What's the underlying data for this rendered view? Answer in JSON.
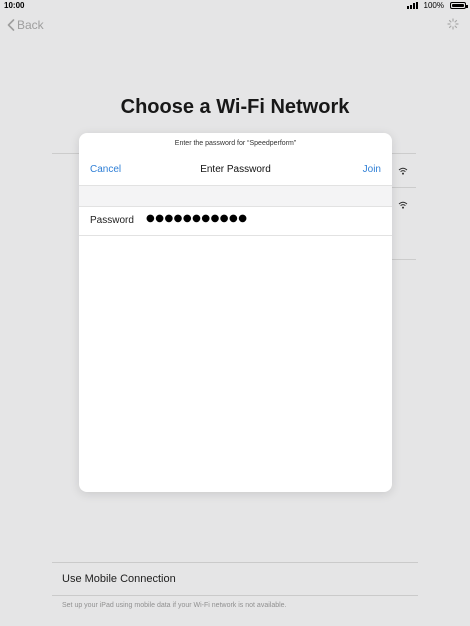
{
  "status_bar": {
    "time": "10:00",
    "battery": "100%"
  },
  "nav": {
    "back_label": "Back"
  },
  "page": {
    "title": "Choose a Wi-Fi Network"
  },
  "modal": {
    "prompt": "Enter the password for “Speedperform”",
    "cancel_label": "Cancel",
    "title": "Enter Password",
    "join_label": "Join",
    "password_label": "Password",
    "password_value": "●●●●●●●●●●●"
  },
  "mobile": {
    "label": "Use Mobile Connection",
    "help": "Set up your iPad using mobile data if your Wi-Fi network is not available."
  },
  "icons": {
    "back": "chevron-left-icon",
    "spinner": "activity-spinner-icon",
    "wifi": "wifi-icon",
    "signal": "cellular-signal-icon",
    "battery": "battery-icon"
  },
  "colors": {
    "accent": "#2f7fd6",
    "background": "#f4f4f5",
    "modal": "#ffffff"
  }
}
